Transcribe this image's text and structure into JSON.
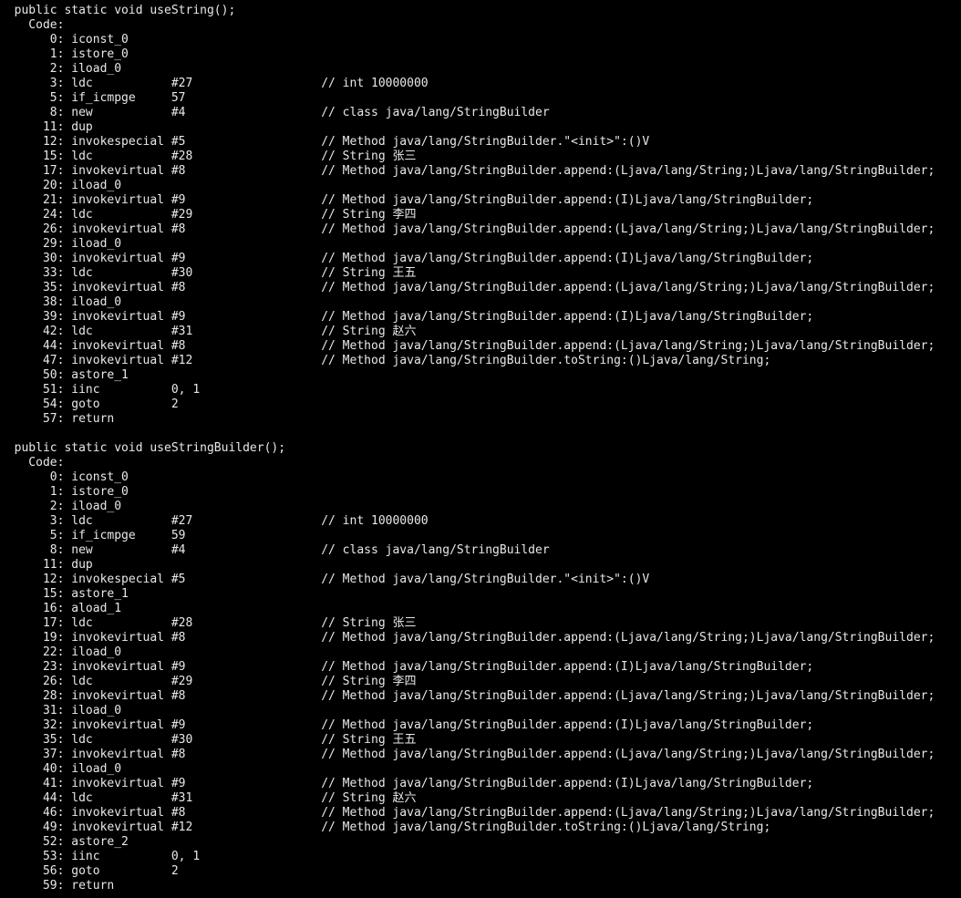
{
  "method1": {
    "signature": "  public static void useString();",
    "code_label": "    Code:",
    "lines": [
      {
        "offset": "0",
        "instr": "iconst_0",
        "arg": "",
        "comment": ""
      },
      {
        "offset": "1",
        "instr": "istore_0",
        "arg": "",
        "comment": ""
      },
      {
        "offset": "2",
        "instr": "iload_0",
        "arg": "",
        "comment": ""
      },
      {
        "offset": "3",
        "instr": "ldc",
        "arg": "#27",
        "comment": "// int 10000000"
      },
      {
        "offset": "5",
        "instr": "if_icmpge",
        "arg": "57",
        "comment": ""
      },
      {
        "offset": "8",
        "instr": "new",
        "arg": "#4",
        "comment": "// class java/lang/StringBuilder"
      },
      {
        "offset": "11",
        "instr": "dup",
        "arg": "",
        "comment": ""
      },
      {
        "offset": "12",
        "instr": "invokespecial",
        "arg": "#5",
        "comment": "// Method java/lang/StringBuilder.\"<init>\":()V"
      },
      {
        "offset": "15",
        "instr": "ldc",
        "arg": "#28",
        "comment": "// String 张三"
      },
      {
        "offset": "17",
        "instr": "invokevirtual",
        "arg": "#8",
        "comment": "// Method java/lang/StringBuilder.append:(Ljava/lang/String;)Ljava/lang/StringBuilder;"
      },
      {
        "offset": "20",
        "instr": "iload_0",
        "arg": "",
        "comment": ""
      },
      {
        "offset": "21",
        "instr": "invokevirtual",
        "arg": "#9",
        "comment": "// Method java/lang/StringBuilder.append:(I)Ljava/lang/StringBuilder;"
      },
      {
        "offset": "24",
        "instr": "ldc",
        "arg": "#29",
        "comment": "// String 李四"
      },
      {
        "offset": "26",
        "instr": "invokevirtual",
        "arg": "#8",
        "comment": "// Method java/lang/StringBuilder.append:(Ljava/lang/String;)Ljava/lang/StringBuilder;"
      },
      {
        "offset": "29",
        "instr": "iload_0",
        "arg": "",
        "comment": ""
      },
      {
        "offset": "30",
        "instr": "invokevirtual",
        "arg": "#9",
        "comment": "// Method java/lang/StringBuilder.append:(I)Ljava/lang/StringBuilder;"
      },
      {
        "offset": "33",
        "instr": "ldc",
        "arg": "#30",
        "comment": "// String 王五"
      },
      {
        "offset": "35",
        "instr": "invokevirtual",
        "arg": "#8",
        "comment": "// Method java/lang/StringBuilder.append:(Ljava/lang/String;)Ljava/lang/StringBuilder;"
      },
      {
        "offset": "38",
        "instr": "iload_0",
        "arg": "",
        "comment": ""
      },
      {
        "offset": "39",
        "instr": "invokevirtual",
        "arg": "#9",
        "comment": "// Method java/lang/StringBuilder.append:(I)Ljava/lang/StringBuilder;"
      },
      {
        "offset": "42",
        "instr": "ldc",
        "arg": "#31",
        "comment": "// String 赵六"
      },
      {
        "offset": "44",
        "instr": "invokevirtual",
        "arg": "#8",
        "comment": "// Method java/lang/StringBuilder.append:(Ljava/lang/String;)Ljava/lang/StringBuilder;"
      },
      {
        "offset": "47",
        "instr": "invokevirtual",
        "arg": "#12",
        "comment": "// Method java/lang/StringBuilder.toString:()Ljava/lang/String;"
      },
      {
        "offset": "50",
        "instr": "astore_1",
        "arg": "",
        "comment": ""
      },
      {
        "offset": "51",
        "instr": "iinc",
        "arg": "0, 1",
        "comment": ""
      },
      {
        "offset": "54",
        "instr": "goto",
        "arg": "2",
        "comment": ""
      },
      {
        "offset": "57",
        "instr": "return",
        "arg": "",
        "comment": ""
      }
    ]
  },
  "method2": {
    "signature": "  public static void useStringBuilder();",
    "code_label": "    Code:",
    "lines": [
      {
        "offset": "0",
        "instr": "iconst_0",
        "arg": "",
        "comment": ""
      },
      {
        "offset": "1",
        "instr": "istore_0",
        "arg": "",
        "comment": ""
      },
      {
        "offset": "2",
        "instr": "iload_0",
        "arg": "",
        "comment": ""
      },
      {
        "offset": "3",
        "instr": "ldc",
        "arg": "#27",
        "comment": "// int 10000000"
      },
      {
        "offset": "5",
        "instr": "if_icmpge",
        "arg": "59",
        "comment": ""
      },
      {
        "offset": "8",
        "instr": "new",
        "arg": "#4",
        "comment": "// class java/lang/StringBuilder"
      },
      {
        "offset": "11",
        "instr": "dup",
        "arg": "",
        "comment": ""
      },
      {
        "offset": "12",
        "instr": "invokespecial",
        "arg": "#5",
        "comment": "// Method java/lang/StringBuilder.\"<init>\":()V"
      },
      {
        "offset": "15",
        "instr": "astore_1",
        "arg": "",
        "comment": ""
      },
      {
        "offset": "16",
        "instr": "aload_1",
        "arg": "",
        "comment": ""
      },
      {
        "offset": "17",
        "instr": "ldc",
        "arg": "#28",
        "comment": "// String 张三"
      },
      {
        "offset": "19",
        "instr": "invokevirtual",
        "arg": "#8",
        "comment": "// Method java/lang/StringBuilder.append:(Ljava/lang/String;)Ljava/lang/StringBuilder;"
      },
      {
        "offset": "22",
        "instr": "iload_0",
        "arg": "",
        "comment": ""
      },
      {
        "offset": "23",
        "instr": "invokevirtual",
        "arg": "#9",
        "comment": "// Method java/lang/StringBuilder.append:(I)Ljava/lang/StringBuilder;"
      },
      {
        "offset": "26",
        "instr": "ldc",
        "arg": "#29",
        "comment": "// String 李四"
      },
      {
        "offset": "28",
        "instr": "invokevirtual",
        "arg": "#8",
        "comment": "// Method java/lang/StringBuilder.append:(Ljava/lang/String;)Ljava/lang/StringBuilder;"
      },
      {
        "offset": "31",
        "instr": "iload_0",
        "arg": "",
        "comment": ""
      },
      {
        "offset": "32",
        "instr": "invokevirtual",
        "arg": "#9",
        "comment": "// Method java/lang/StringBuilder.append:(I)Ljava/lang/StringBuilder;"
      },
      {
        "offset": "35",
        "instr": "ldc",
        "arg": "#30",
        "comment": "// String 王五"
      },
      {
        "offset": "37",
        "instr": "invokevirtual",
        "arg": "#8",
        "comment": "// Method java/lang/StringBuilder.append:(Ljava/lang/String;)Ljava/lang/StringBuilder;"
      },
      {
        "offset": "40",
        "instr": "iload_0",
        "arg": "",
        "comment": ""
      },
      {
        "offset": "41",
        "instr": "invokevirtual",
        "arg": "#9",
        "comment": "// Method java/lang/StringBuilder.append:(I)Ljava/lang/StringBuilder;"
      },
      {
        "offset": "44",
        "instr": "ldc",
        "arg": "#31",
        "comment": "// String 赵六"
      },
      {
        "offset": "46",
        "instr": "invokevirtual",
        "arg": "#8",
        "comment": "// Method java/lang/StringBuilder.append:(Ljava/lang/String;)Ljava/lang/StringBuilder;"
      },
      {
        "offset": "49",
        "instr": "invokevirtual",
        "arg": "#12",
        "comment": "// Method java/lang/StringBuilder.toString:()Ljava/lang/String;"
      },
      {
        "offset": "52",
        "instr": "astore_2",
        "arg": "",
        "comment": ""
      },
      {
        "offset": "53",
        "instr": "iinc",
        "arg": "0, 1",
        "comment": ""
      },
      {
        "offset": "56",
        "instr": "goto",
        "arg": "2",
        "comment": ""
      },
      {
        "offset": "59",
        "instr": "return",
        "arg": "",
        "comment": ""
      }
    ]
  }
}
